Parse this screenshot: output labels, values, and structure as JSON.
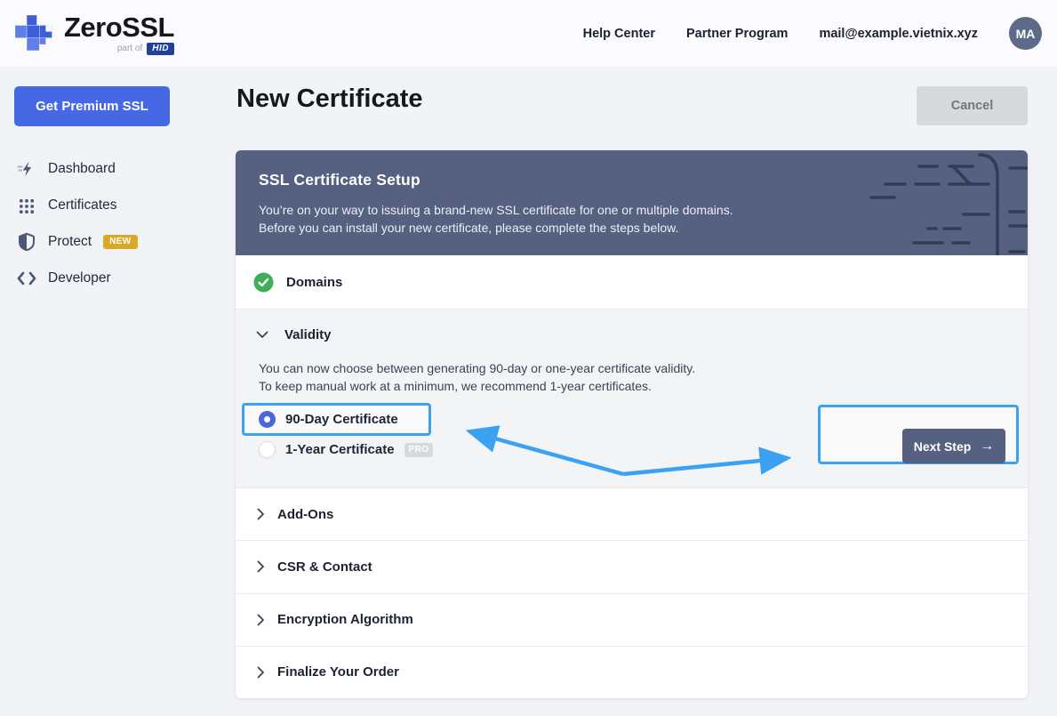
{
  "topbar": {
    "logo": {
      "name": "ZeroSSL",
      "sub": "part of",
      "badge": "HID"
    },
    "links": [
      {
        "label": "Help Center"
      },
      {
        "label": "Partner Program"
      }
    ],
    "email": "mail@example.vietnix.xyz",
    "avatar_initials": "MA"
  },
  "sidebar": {
    "premium_button": "Get Premium SSL",
    "items": [
      {
        "label": "Dashboard",
        "icon": "bolt-icon"
      },
      {
        "label": "Certificates",
        "icon": "grid-icon"
      },
      {
        "label": "Protect",
        "icon": "shield-icon",
        "badge": "NEW"
      },
      {
        "label": "Developer",
        "icon": "code-icon"
      }
    ]
  },
  "page": {
    "title": "New Certificate",
    "cancel_label": "Cancel"
  },
  "card": {
    "header": {
      "title": "SSL Certificate Setup",
      "line1": "You’re on your way to issuing a brand-new SSL certificate for one or multiple domains.",
      "line2": "Before you can install your new certificate, please complete the steps below."
    },
    "domains": {
      "label": "Domains",
      "status": "complete"
    },
    "validity": {
      "label": "Validity",
      "desc1": "You can now choose between generating 90-day or one-year certificate validity.",
      "desc2": "To keep manual work at a minimum, we recommend 1-year certificates.",
      "options": [
        {
          "label": "90-Day Certificate",
          "selected": true
        },
        {
          "label": "1-Year Certificate",
          "selected": false,
          "badge": "PRO"
        }
      ],
      "next_label": "Next Step",
      "next_arrow": "→"
    },
    "collapsed": [
      {
        "label": "Add-Ons"
      },
      {
        "label": "CSR & Contact"
      },
      {
        "label": "Encryption Algorithm"
      },
      {
        "label": "Finalize Your Order"
      }
    ]
  },
  "colors": {
    "brand_blue": "#4569e4",
    "slate_header": "#566080",
    "annotation_blue": "#3ba1f2",
    "success_green": "#3fae56",
    "badge_new_gold": "#d9a826"
  }
}
